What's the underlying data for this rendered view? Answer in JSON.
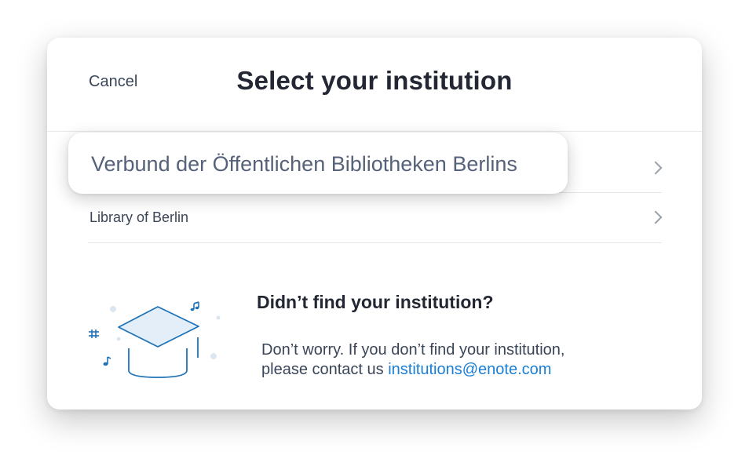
{
  "header": {
    "cancel_label": "Cancel",
    "title": "Select your institution"
  },
  "institutions": [
    {
      "name": "Verbund der Öffentlichen Bibliotheken Berlins"
    },
    {
      "name": "Library of Berlin"
    }
  ],
  "highlight": {
    "label": "Verbund der Öffentlichen Bibliotheken Berlins"
  },
  "not_found": {
    "title": "Didn’t find your institution?",
    "line1": "Don’t worry. If you don’t find your institution,",
    "line2_prefix": "please contact us ",
    "email": "institutions@enote.com"
  },
  "colors": {
    "accent": "#1a7fd6",
    "illustration_stroke": "#1e73b8",
    "illustration_fill": "#e4eef8",
    "text_primary": "#222733",
    "text_secondary": "#3b4558"
  },
  "icons": [
    "graduation-cap-icon",
    "music-note-icon",
    "hash-icon",
    "chevron-right-icon"
  ]
}
